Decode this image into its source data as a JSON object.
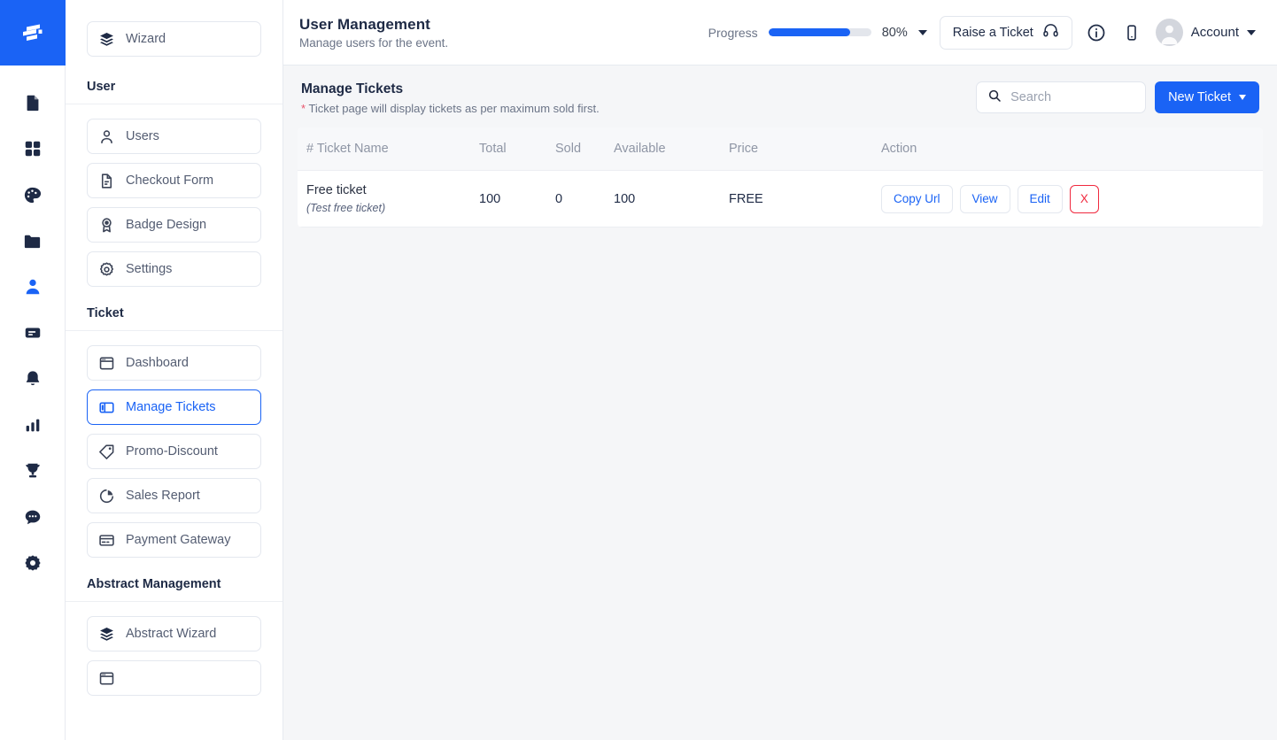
{
  "brand": {
    "logo_icon": "stacked-bars-logo",
    "accent": "#1a63f5",
    "danger": "#f0293e"
  },
  "rail": {
    "items": [
      {
        "icon": "document-icon",
        "name": "document"
      },
      {
        "icon": "grid-icon",
        "name": "dashboard"
      },
      {
        "icon": "palette-icon",
        "name": "design"
      },
      {
        "icon": "folder-icon",
        "name": "files"
      },
      {
        "icon": "user-icon",
        "name": "users",
        "active": true
      },
      {
        "icon": "message-box-icon",
        "name": "messages"
      },
      {
        "icon": "bell-icon",
        "name": "notifications"
      },
      {
        "icon": "bar-chart-icon",
        "name": "analytics"
      },
      {
        "icon": "trophy-icon",
        "name": "awards"
      },
      {
        "icon": "chat-bubble-icon",
        "name": "chat"
      },
      {
        "icon": "gear-icon",
        "name": "settings"
      }
    ]
  },
  "header": {
    "title": "User Management",
    "subtitle": "Manage users for the event.",
    "progress_label": "Progress",
    "progress_percent": "80%",
    "progress_value": 80,
    "raise_ticket_label": "Raise a Ticket",
    "account_label": "Account"
  },
  "sidebar": {
    "top": [
      {
        "label": "Wizard",
        "icon": "layers-icon"
      }
    ],
    "sections": [
      {
        "title": "User",
        "items": [
          {
            "label": "Users",
            "icon": "user-outline-icon"
          },
          {
            "label": "Checkout Form",
            "icon": "file-text-icon"
          },
          {
            "label": "Badge Design",
            "icon": "badge-icon"
          },
          {
            "label": "Settings",
            "icon": "gear-icon"
          }
        ]
      },
      {
        "title": "Ticket",
        "items": [
          {
            "label": "Dashboard",
            "icon": "window-icon"
          },
          {
            "label": "Manage Tickets",
            "icon": "panel-icon",
            "active": true
          },
          {
            "label": "Promo-Discount",
            "icon": "tag-icon"
          },
          {
            "label": "Sales Report",
            "icon": "pie-chart-icon"
          },
          {
            "label": "Payment Gateway",
            "icon": "credit-card-icon"
          }
        ]
      },
      {
        "title": "Abstract Management",
        "items": [
          {
            "label": "Abstract Wizard",
            "icon": "layers-icon"
          },
          {
            "label": "",
            "icon": "window-icon",
            "partial": true
          }
        ]
      }
    ]
  },
  "main": {
    "title": "Manage Tickets",
    "note_star": "*",
    "note": "Ticket page will display tickets as per maximum sold first.",
    "search": {
      "placeholder": "Search",
      "value": "",
      "icon": "search-icon"
    },
    "new_ticket_label": "New Ticket",
    "table": {
      "columns": [
        "# Ticket Name",
        "Total",
        "Sold",
        "Available",
        "Price",
        "Action"
      ],
      "rows": [
        {
          "name": "Free ticket",
          "subtitle": "(Test free ticket)",
          "total": "100",
          "sold": "0",
          "available": "100",
          "price": "FREE",
          "actions": [
            {
              "label": "Copy Url",
              "style": "link"
            },
            {
              "label": "View",
              "style": "link"
            },
            {
              "label": "Edit",
              "style": "link"
            },
            {
              "label": "X",
              "style": "danger"
            }
          ]
        }
      ]
    }
  }
}
